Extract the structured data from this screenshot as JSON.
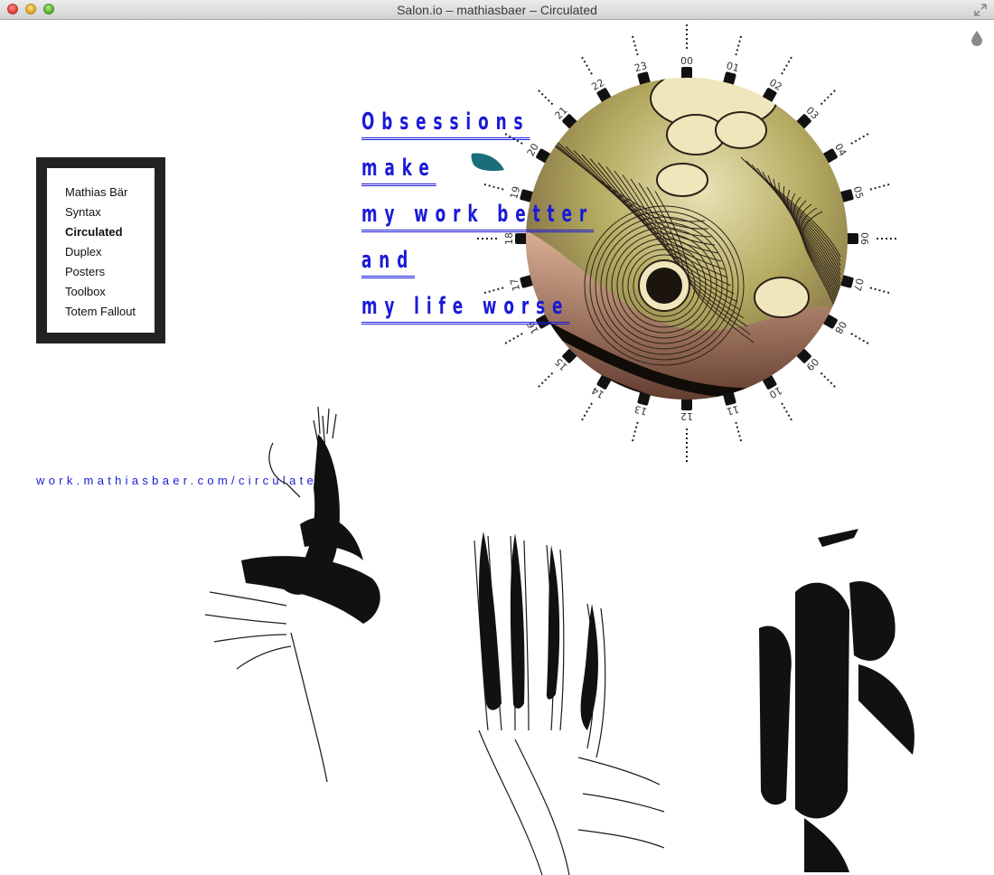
{
  "window": {
    "title": "Salon.io – mathiasbaer – Circulated"
  },
  "nav": {
    "items": [
      {
        "label": "Mathias Bär",
        "active": false
      },
      {
        "label": "Syntax",
        "active": false
      },
      {
        "label": "Circulated",
        "active": true
      },
      {
        "label": "Duplex",
        "active": false
      },
      {
        "label": "Posters",
        "active": false
      },
      {
        "label": "Toolbox",
        "active": false
      },
      {
        "label": "Totem Fallout",
        "active": false
      }
    ]
  },
  "quote": {
    "lines": [
      "Obsessions",
      "make",
      "my work better",
      "and",
      "my life worse"
    ]
  },
  "link": {
    "url_text": "work.mathiasbaer.com/circulated"
  },
  "clock": {
    "hour_labels": [
      "00",
      "01",
      "02",
      "03",
      "04",
      "05",
      "06",
      "07",
      "08",
      "09",
      "10",
      "11",
      "12",
      "13",
      "14",
      "15",
      "16",
      "17",
      "18",
      "19",
      "20",
      "21",
      "22",
      "23"
    ]
  },
  "icons": {
    "drop": "water-drop-icon",
    "fullscreen": "fullscreen-icon"
  },
  "colors": {
    "link_blue": "#1a1ad8",
    "nav_frame": "#232323",
    "drop_teal": "#1a6d7a",
    "drop_gray": "#8a8a8a"
  }
}
